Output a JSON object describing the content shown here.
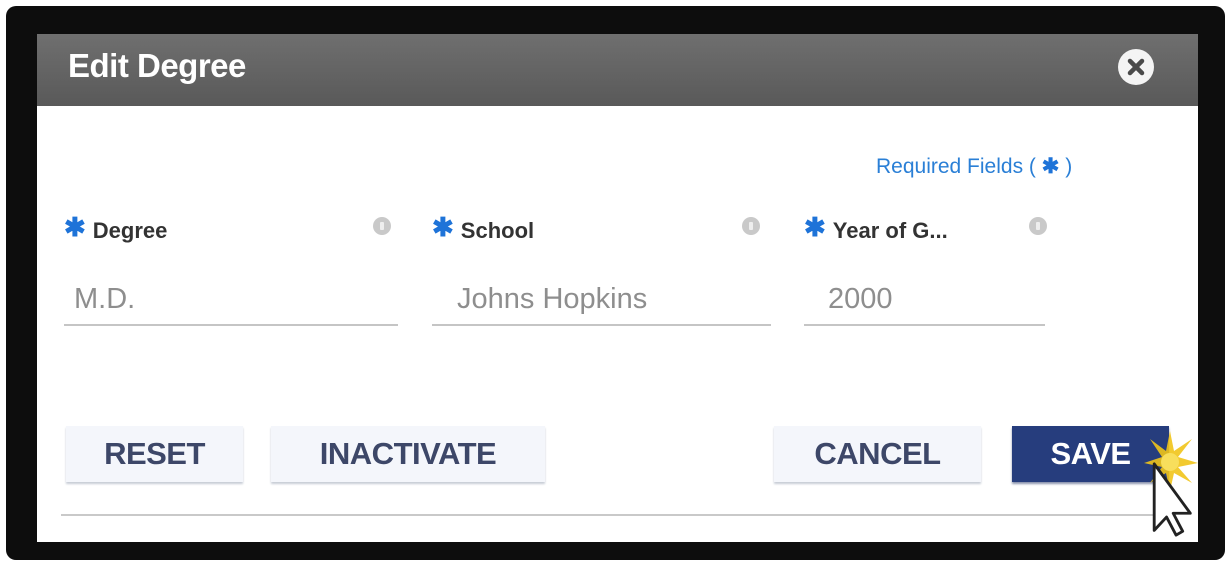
{
  "dialog": {
    "title": "Edit Degree",
    "close_icon": "close-icon"
  },
  "required_note": {
    "prefix": "Required Fields (",
    "star": "✱",
    "suffix": ")"
  },
  "fields": [
    {
      "label": "Degree",
      "value": "M.D.",
      "required": true
    },
    {
      "label": "School",
      "value": "Johns Hopkins",
      "required": true
    },
    {
      "label": "Year of G...",
      "value": "2000",
      "required": true
    }
  ],
  "buttons": {
    "reset": "RESET",
    "inactivate": "INACTIVATE",
    "cancel": "CANCEL",
    "save": "SAVE"
  },
  "colors": {
    "titlebar": "#626262",
    "accent_blue": "#1e73d8",
    "save_button": "#263d7d",
    "button_text": "#3d4768"
  },
  "icons": [
    "close-icon",
    "info-icon",
    "required-star-icon",
    "mouse-pointer-icon",
    "click-burst-icon"
  ]
}
